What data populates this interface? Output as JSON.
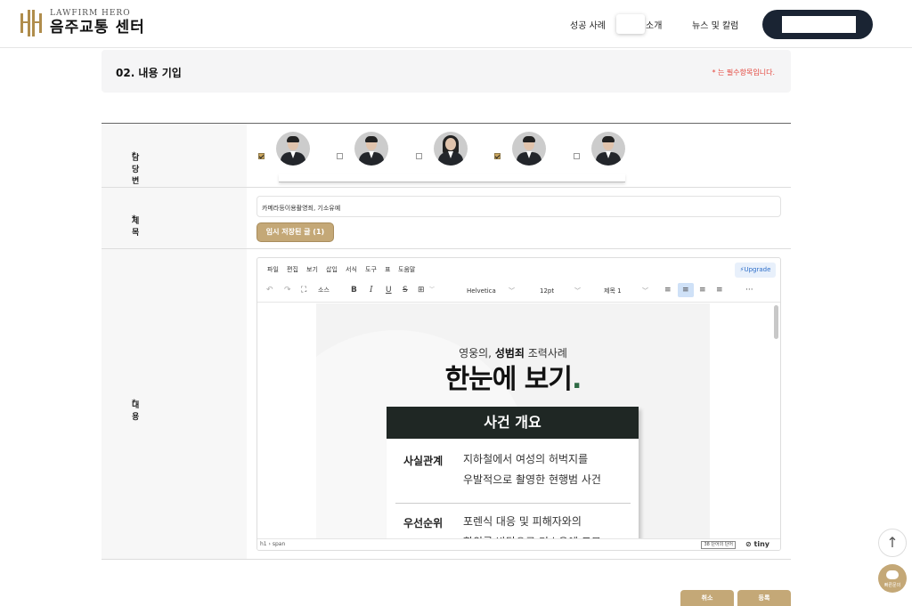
{
  "header": {
    "logo_en": "LAWFIRM HERO",
    "logo_ko": "음주교통 센터",
    "nav": [
      "성공 사례",
      "소개",
      "뉴스 및 칼럼"
    ]
  },
  "section": {
    "title": "02. 내용 기입",
    "required_note": "* 는 필수항목입니다."
  },
  "form": {
    "lawyer_label": "담당 변호사",
    "required_mark": "*",
    "lawyers": [
      {
        "checked": true,
        "gender": "m"
      },
      {
        "checked": false,
        "gender": "m"
      },
      {
        "checked": false,
        "gender": "f"
      },
      {
        "checked": true,
        "gender": "m"
      },
      {
        "checked": false,
        "gender": "m"
      }
    ],
    "title_label": "제목",
    "title_value": "카메라등이용촬영죄, 기소유예",
    "draft_button": "임시 저장된 글 (1)",
    "content_label": "내용"
  },
  "editor": {
    "menu": [
      "파일",
      "편집",
      "보기",
      "삽입",
      "서식",
      "도구",
      "표",
      "도움말"
    ],
    "upgrade": "⚡Upgrade",
    "source_label": "소스",
    "font_family": "Helvetica",
    "font_size": "12pt",
    "block_format": "제목 1",
    "doc_kicker_pre": "영웅의, ",
    "doc_kicker_bold": "성범죄",
    "doc_kicker_post": " 조력사례",
    "doc_heading": "한눈에 보기",
    "doc_heading_dot": ".",
    "card_title": "사건 개요",
    "card_rows": [
      {
        "key": "사실관계",
        "lines": [
          "지하철에서 여성의 허벅지를",
          "우발적으로 촬영한 현행범 사건"
        ]
      },
      {
        "key": "우선순위",
        "lines": [
          "포렌식 대응 및 피해자와의",
          "합의를 바탕으로 기소유예 도모"
        ]
      }
    ],
    "status_path": "h1 › span",
    "word_count": "38 단어의 단어",
    "brand": "tiny"
  },
  "buttons": {
    "cancel": "취소",
    "submit": "등록"
  },
  "fab": {
    "top": "↑",
    "chat": "빠른문의"
  },
  "colors": {
    "accent": "#c4a877",
    "navy": "#1a2433",
    "required": "#e4443b"
  }
}
